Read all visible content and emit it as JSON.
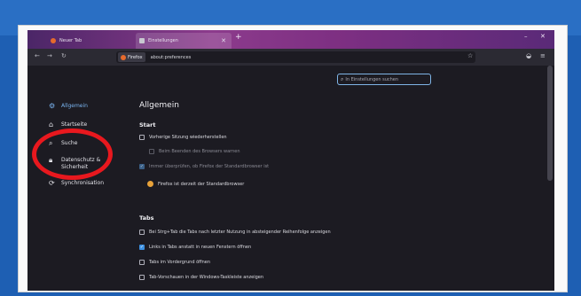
{
  "tabs": [
    {
      "label": "Neuer Tab"
    },
    {
      "label": "Einstellungen"
    }
  ],
  "toolbar": {
    "identity_label": "Firefox",
    "url": "about:preferences"
  },
  "search": {
    "placeholder": "In Einstellungen suchen"
  },
  "sidebar": {
    "items": [
      {
        "label": "Allgemein"
      },
      {
        "label": "Startseite"
      },
      {
        "label": "Suche"
      },
      {
        "label": "Datenschutz & Sicherheit"
      },
      {
        "label": "Synchronisation"
      }
    ]
  },
  "main": {
    "heading": "Allgemein",
    "start_section": {
      "title": "Start",
      "options": [
        {
          "label": "Vorherige Sitzung wiederherstellen",
          "checked": false,
          "disabled": false
        },
        {
          "label": "Beim Beenden des Browsers warnen",
          "checked": false,
          "disabled": true
        },
        {
          "label": "Immer überprüfen, ob Firefox der Standardbrowser ist",
          "checked": true,
          "disabled": true
        }
      ],
      "default_browser_status": "Firefox ist derzeit der Standardbrowser"
    },
    "tabs_section": {
      "title": "Tabs",
      "options": [
        {
          "label": "Bei Strg+Tab die Tabs nach letzter Nutzung in absteigender Reihenfolge anzeigen",
          "checked": false
        },
        {
          "label": "Links in Tabs anstatt in neuen Fenstern öffnen",
          "checked": true
        },
        {
          "label": "Tabs im Vordergrund öffnen",
          "checked": false
        },
        {
          "label": "Tab-Vorschauen in der Windows-Taskleiste anzeigen",
          "checked": false
        }
      ]
    }
  },
  "colors": {
    "accent": "#3b8fe0",
    "highlight_circle": "#e8181e"
  }
}
